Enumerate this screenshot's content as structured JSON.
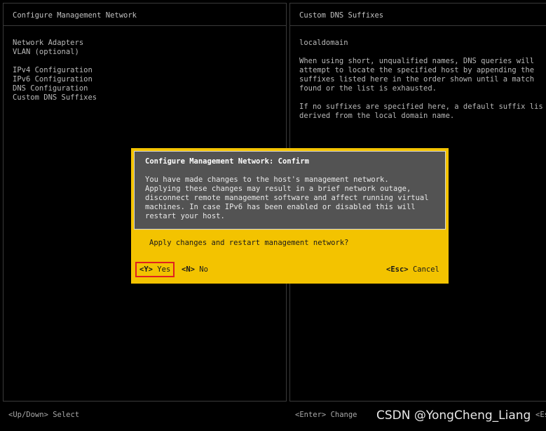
{
  "left_pane": {
    "title": "Configure Management Network",
    "menu": [
      "Network Adapters",
      "VLAN (optional)",
      "",
      "IPv4 Configuration",
      "IPv6 Configuration",
      "DNS Configuration",
      "Custom DNS Suffixes"
    ]
  },
  "right_pane": {
    "title": "Custom DNS Suffixes",
    "value": "localdomain",
    "description_lines": [
      "When using short, unqualified names, DNS queries will",
      "attempt to locate the specified host by appending the",
      "suffixes listed here in the order shown until a match",
      "found or the list is exhausted."
    ],
    "note_lines": [
      "If no suffixes are specified here, a default suffix lis",
      "derived from the local domain name."
    ]
  },
  "dialog": {
    "title": "Configure Management Network: Confirm",
    "message_lines": [
      "You have made changes to the host's management network.",
      "Applying these changes may result in a brief network outage,",
      "disconnect remote management software and affect running virtual",
      "machines. In case IPv6 has been enabled or disabled this will",
      "restart your host."
    ],
    "question": "Apply changes and restart management network?",
    "yes": {
      "key": "<Y>",
      "label": "Yes"
    },
    "no": {
      "key": "<N>",
      "label": "No"
    },
    "cancel": {
      "key": "<Esc>",
      "label": "Cancel"
    },
    "colors": {
      "accent": "#f3c300",
      "panel": "#535353",
      "highlight": "#e02020"
    }
  },
  "footer": {
    "left": "<Up/Down> Select",
    "right": "<Enter> Change",
    "esc": "<Esc"
  },
  "watermark": "CSDN @YongCheng_Liang"
}
